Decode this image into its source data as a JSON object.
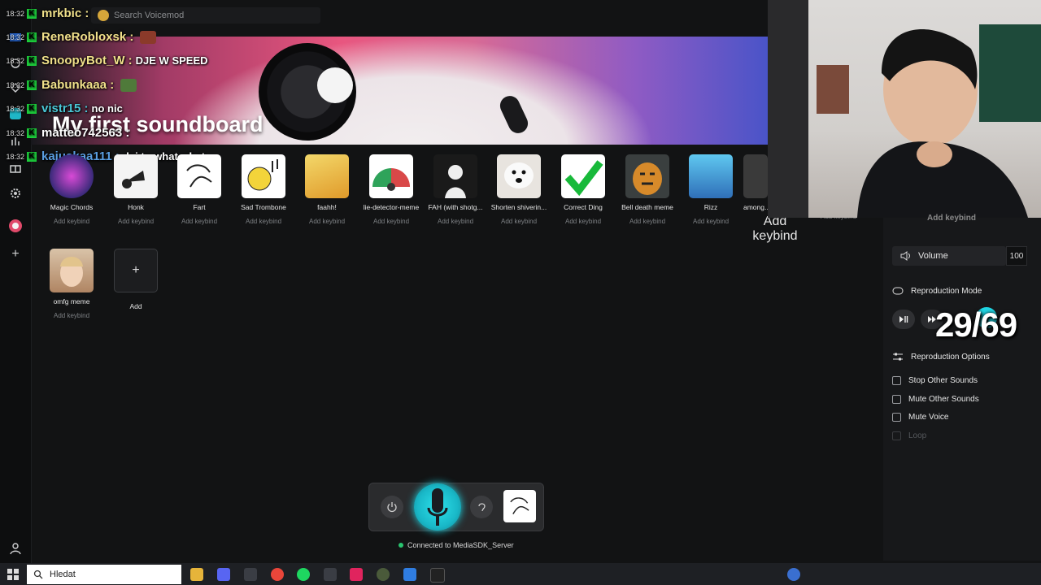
{
  "search": {
    "placeholder": "Search Voicemod"
  },
  "banner": {
    "title": "My first soundboard"
  },
  "chat": [
    {
      "time": "18:32",
      "user": "mrkbic :",
      "msg": ""
    },
    {
      "time": "18:32",
      "user": "ReneRobloxsk :",
      "msg": ""
    },
    {
      "time": "18:32",
      "user": "SnoopyBot_W :",
      "msg": "DJE W SPEED"
    },
    {
      "time": "18:32",
      "user": "Babunkaaa :",
      "msg": ""
    },
    {
      "time": "18:32",
      "user": "vistr15 :",
      "msg": "no nic"
    },
    {
      "time": "18:32",
      "user": "matteo742563 :",
      "msg": ""
    },
    {
      "time": "18:32",
      "user": "kajuskaa111 :",
      "msg": "dej to what what"
    }
  ],
  "sounds": [
    {
      "name": "Magic Chords",
      "keybind": "Add keybind",
      "color": "#3a2a7a"
    },
    {
      "name": "Honk",
      "keybind": "Add keybind",
      "color": "#f4f4f4"
    },
    {
      "name": "Fart",
      "keybind": "Add keybind",
      "color": "#ffffff"
    },
    {
      "name": "Sad Trombone",
      "keybind": "Add keybind",
      "color": "#ffffff"
    },
    {
      "name": "faahh!",
      "keybind": "Add keybind",
      "color": "#e9b23c"
    },
    {
      "name": "lie-detector-meme",
      "keybind": "Add keybind",
      "color": "#d94848"
    },
    {
      "name": "FAH (with shotg...",
      "keybind": "Add keybind",
      "color": "#1a1a1a"
    },
    {
      "name": "Shorten shiverin...",
      "keybind": "Add keybind",
      "color": "#e8e4df"
    },
    {
      "name": "Correct Ding",
      "keybind": "Add keybind",
      "color": "#ffffff"
    },
    {
      "name": "Bell death meme",
      "keybind": "Add keybind",
      "color": "#d78a2a"
    },
    {
      "name": "Rizz",
      "keybind": "Add keybind",
      "color": "#3aa0d8"
    },
    {
      "name": "among...",
      "keybind": "Add keybind",
      "color": "#3a3a3a"
    },
    {
      "name": "",
      "keybind": "Add keybind",
      "color": ""
    },
    {
      "name": "omfg meme",
      "keybind": "Add keybind",
      "color": "#c9a98a"
    }
  ],
  "add_tile": {
    "label": "Add",
    "icon": "+"
  },
  "panel": {
    "add_keybind": "Add keybind",
    "volume_label": "Volume",
    "volume_value": "100",
    "reproduction_mode": "Reproduction Mode",
    "reproduction_options": "Reproduction Options",
    "options": [
      {
        "label": "Stop Other Sounds",
        "checked": false,
        "enabled": true
      },
      {
        "label": "Mute Other Sounds",
        "checked": false,
        "enabled": true
      },
      {
        "label": "Mute Voice",
        "checked": false,
        "enabled": true
      },
      {
        "label": "Loop",
        "checked": false,
        "enabled": false
      }
    ]
  },
  "overlay_counter": "29/69",
  "status": {
    "text": "Connected to MediaSDK_Server"
  },
  "taskbar": {
    "search_placeholder": "Hledat"
  },
  "colors": {
    "accent": "#1fd5e3",
    "badge": "#1dcf3c",
    "connected": "#29c46f"
  }
}
